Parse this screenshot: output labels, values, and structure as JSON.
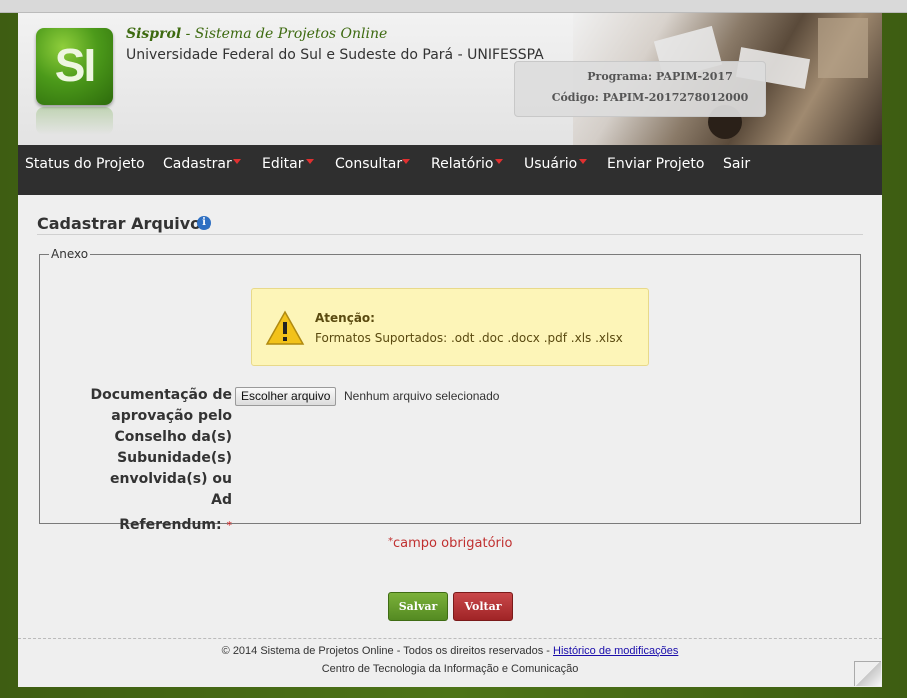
{
  "header": {
    "app_name": "Sisprol",
    "app_subtitle": " - Sistema de Projetos Online",
    "university": "Universidade Federal do Sul e Sudeste do Pará - UNIFESSPA",
    "logo_text": "SI",
    "programa": "Programa: PAPIM-2017",
    "codigo": "Código: PAPIM-2017278012000"
  },
  "nav": {
    "items": [
      {
        "label": "Status do Projeto",
        "dropdown": false
      },
      {
        "label": "Cadastrar",
        "dropdown": true
      },
      {
        "label": "Editar",
        "dropdown": true
      },
      {
        "label": "Consultar",
        "dropdown": true
      },
      {
        "label": "Relatório",
        "dropdown": true
      },
      {
        "label": "Usuário",
        "dropdown": true
      },
      {
        "label": "Enviar Projeto",
        "dropdown": false
      },
      {
        "label": "Sair",
        "dropdown": false
      }
    ]
  },
  "page": {
    "title": "Cadastrar Arquivos",
    "info_icon": "info-icon"
  },
  "form": {
    "legend": "Anexo",
    "alert_title": "Atenção:",
    "alert_text": "Formatos Suportados: .odt .doc .docx .pdf .xls .xlsx",
    "file_field_label_lines": [
      "Documentação de",
      "aprovação pelo",
      "Conselho da(s)",
      "Subunidade(s)",
      "envolvida(s) ou Ad",
      "Referendum:"
    ],
    "required_star": "*",
    "file_button": "Escolher arquivo",
    "file_status": "Nenhum arquivo selecionado",
    "required_note": "campo obrigatório"
  },
  "buttons": {
    "save": "Salvar",
    "back": "Voltar"
  },
  "footer": {
    "copyright": "© 2014 Sistema de Projetos Online - Todos os direitos reservados - ",
    "history_link": "Histórico de modificações",
    "org": "Centro de Tecnologia da Informação e Comunicação"
  },
  "colors": {
    "nav_bg": "#2f2f2f",
    "accent_green": "#3d6a10",
    "alert_bg": "#fdf5b8",
    "save_btn": "#6a9f2e",
    "back_btn": "#b5383a",
    "required_red": "#c03030"
  }
}
